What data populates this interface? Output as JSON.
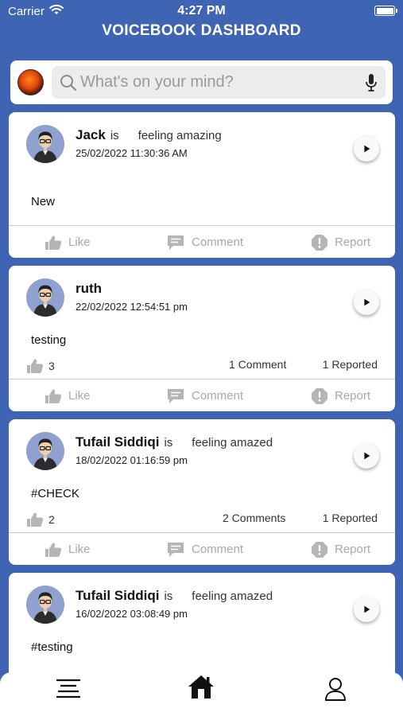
{
  "status_bar": {
    "carrier": "Carrier",
    "time": "4:27 PM"
  },
  "header": {
    "title": "VOICEBOOK DASHBOARD"
  },
  "search": {
    "placeholder": "What's on your mind?"
  },
  "actions": {
    "like": "Like",
    "comment": "Comment",
    "report": "Report"
  },
  "posts": [
    {
      "username": "Jack",
      "is": "is",
      "feeling": "feeling amazing",
      "date": "25/02/2022 11:30:36 AM",
      "text": "New"
    },
    {
      "username": "ruth",
      "date": "22/02/2022 12:54:51 pm",
      "text": "testing",
      "likes": "3",
      "comments": "1 Comment",
      "reports": "1 Reported"
    },
    {
      "username": "Tufail Siddiqi",
      "is": "is",
      "feeling": "feeling amazed",
      "date": "18/02/2022 01:16:59 pm",
      "text": "#CHECK",
      "likes": "2",
      "comments": "2 Comments",
      "reports": "1 Reported"
    },
    {
      "username": "Tufail Siddiqi",
      "is": "is",
      "feeling": "feeling amazed",
      "date": "16/02/2022 03:08:49 pm",
      "text": "#testing"
    }
  ],
  "colors": {
    "background": "#3f64b4",
    "card": "#ffffff",
    "muted": "#a9a9a9"
  },
  "icons": {
    "tab_bar": [
      "menu-icon",
      "home-icon",
      "profile-icon"
    ],
    "post": [
      "avatar",
      "play-icon",
      "like-icon",
      "comment-icon",
      "report-icon"
    ]
  }
}
